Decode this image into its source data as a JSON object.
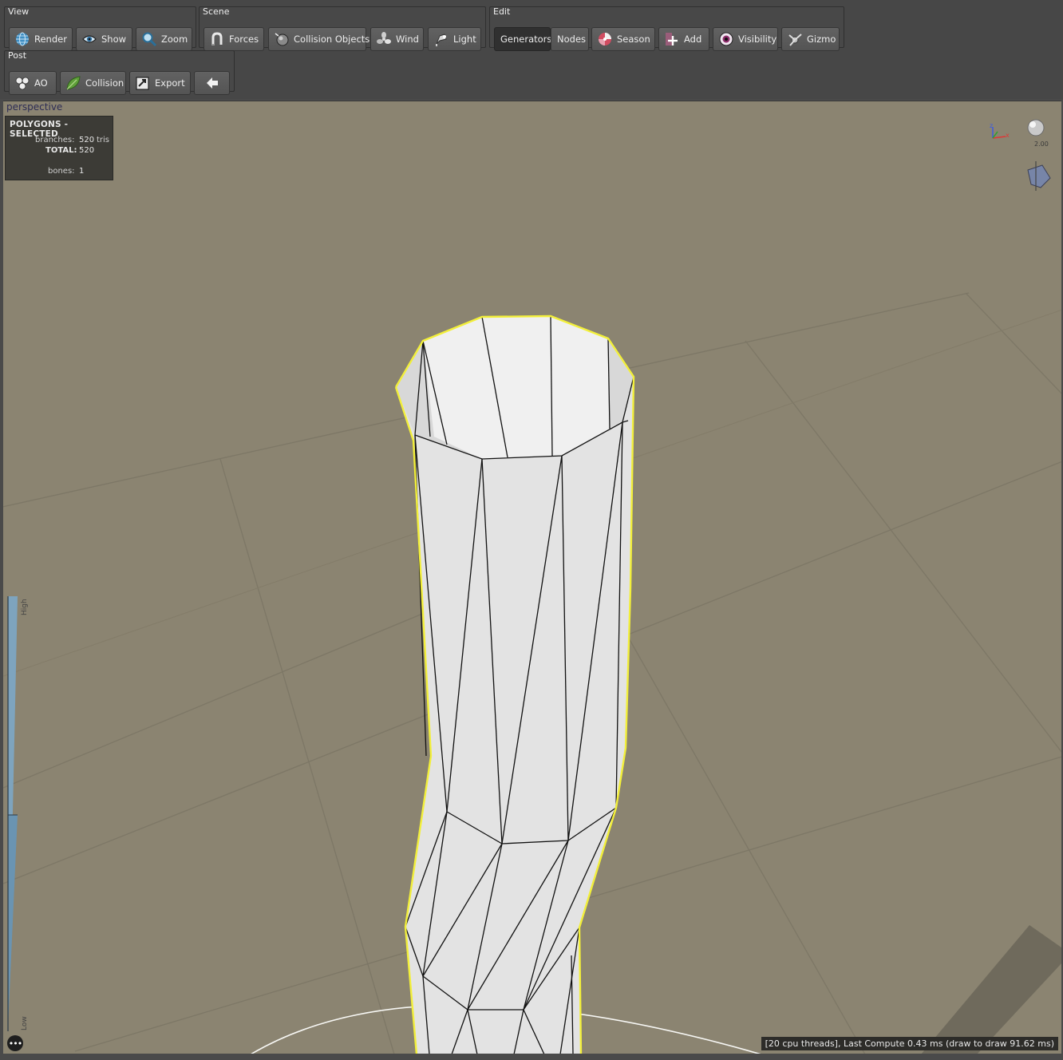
{
  "toolbar": {
    "view": {
      "title": "View",
      "buttons": [
        {
          "label": "Render",
          "icon": "globe-icon"
        },
        {
          "label": "Show",
          "icon": "eye-icon"
        },
        {
          "label": "Zoom",
          "icon": "magnifier-icon"
        }
      ]
    },
    "scene": {
      "title": "Scene",
      "buttons": [
        {
          "label": "Forces",
          "icon": "magnet-icon"
        },
        {
          "label": "Collision Objects",
          "icon": "collision-sphere-icon"
        },
        {
          "label": "Wind",
          "icon": "fan-icon"
        },
        {
          "label": "Light",
          "icon": "spotlight-icon"
        }
      ]
    },
    "edit": {
      "title": "Edit",
      "buttons": [
        {
          "label": "Generators",
          "icon": ""
        },
        {
          "label": "Nodes",
          "icon": ""
        },
        {
          "label": "Season",
          "icon": "season-wheel-icon"
        },
        {
          "label": "Add",
          "icon": "add-plus-icon"
        },
        {
          "label": "Visibility",
          "icon": "visibility-eye-icon"
        },
        {
          "label": "Gizmo",
          "icon": "gizmo-icon"
        }
      ]
    },
    "post": {
      "title": "Post",
      "buttons": [
        {
          "label": "AO",
          "icon": "ao-spheres-icon"
        },
        {
          "label": "Collision",
          "icon": "leaf-icon"
        },
        {
          "label": "Export",
          "icon": "export-icon"
        },
        {
          "label": "",
          "icon": "back-arrow-icon"
        }
      ]
    }
  },
  "viewport": {
    "camera_label": "perspective",
    "stats": {
      "header": "POLYGONS - SELECTED",
      "branches_label": "branches:",
      "branches_value": "520",
      "branches_unit": "tris",
      "total_label": "TOTAL:",
      "total_value": "520",
      "bones_label": "bones:",
      "bones_value": "1"
    },
    "gizmo_scale": "2.00",
    "axis_z": "z",
    "axis_x": "x",
    "gauge_high": "High",
    "gauge_low": "Low",
    "more_label": "•••",
    "status": "[20 cpu threads], Last Compute 0.43 ms (draw to draw 91.62 ms)"
  },
  "colors": {
    "ground": "#8b8471",
    "selection_outline": "#f2ef3a",
    "mesh_fill": "#e6e6e6",
    "toolbar_bg": "#474747"
  }
}
